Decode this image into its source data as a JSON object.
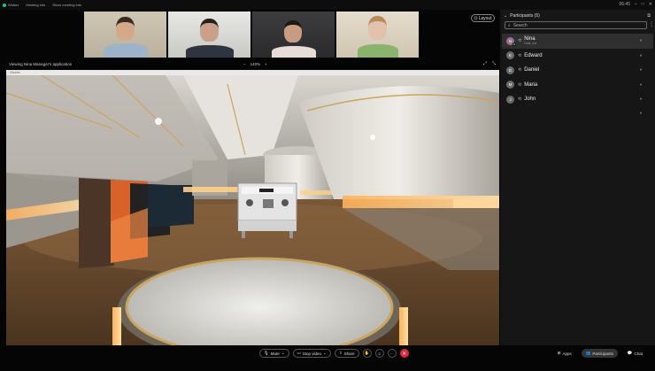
{
  "topbar": {
    "app_name": "Webex",
    "tab2": "Meeting info",
    "tab3": "Show meeting info",
    "right_status": "06:45"
  },
  "video_tiles": [
    {
      "skin": "#d4a98a",
      "hair": "#3a2a20",
      "shirt": "#9cb3c9"
    },
    {
      "skin": "#caa08a",
      "hair": "#2a211b",
      "shirt": "#2f3540"
    },
    {
      "skin": "#c79c82",
      "hair": "#1e1813",
      "shirt": "#e8dcd6"
    },
    {
      "skin": "#e3c2ad",
      "hair": "#b98a58",
      "shirt": "#8ab36b"
    }
  ],
  "layout_button": {
    "label": "Layout"
  },
  "share": {
    "title": "Viewing Nina Manager's application",
    "zoom_minus": "−",
    "zoom_level": "140%",
    "zoom_plus": "+",
    "address": "Stores"
  },
  "participants_panel": {
    "title": "Participants (5)",
    "search_placeholder": "Search",
    "participants": [
      {
        "initial": "N",
        "name": "Nina",
        "sub": "Host, me",
        "selected": true
      },
      {
        "initial": "E",
        "name": "Edward",
        "sub": "",
        "selected": false
      },
      {
        "initial": "D",
        "name": "Daniel",
        "sub": "",
        "selected": false
      },
      {
        "initial": "M",
        "name": "Maria",
        "sub": "",
        "selected": false
      },
      {
        "initial": "J",
        "name": "John",
        "sub": "",
        "selected": false
      }
    ]
  },
  "bottom": {
    "mute_label": "Mute",
    "video_label": "Stop video",
    "share_label": "Share",
    "more_label": "···",
    "apps_label": "Apps",
    "participants_label": "Participants",
    "chat_label": "Chat"
  },
  "colors": {
    "end_call": "#e0243a",
    "panel_bg": "#161616"
  }
}
